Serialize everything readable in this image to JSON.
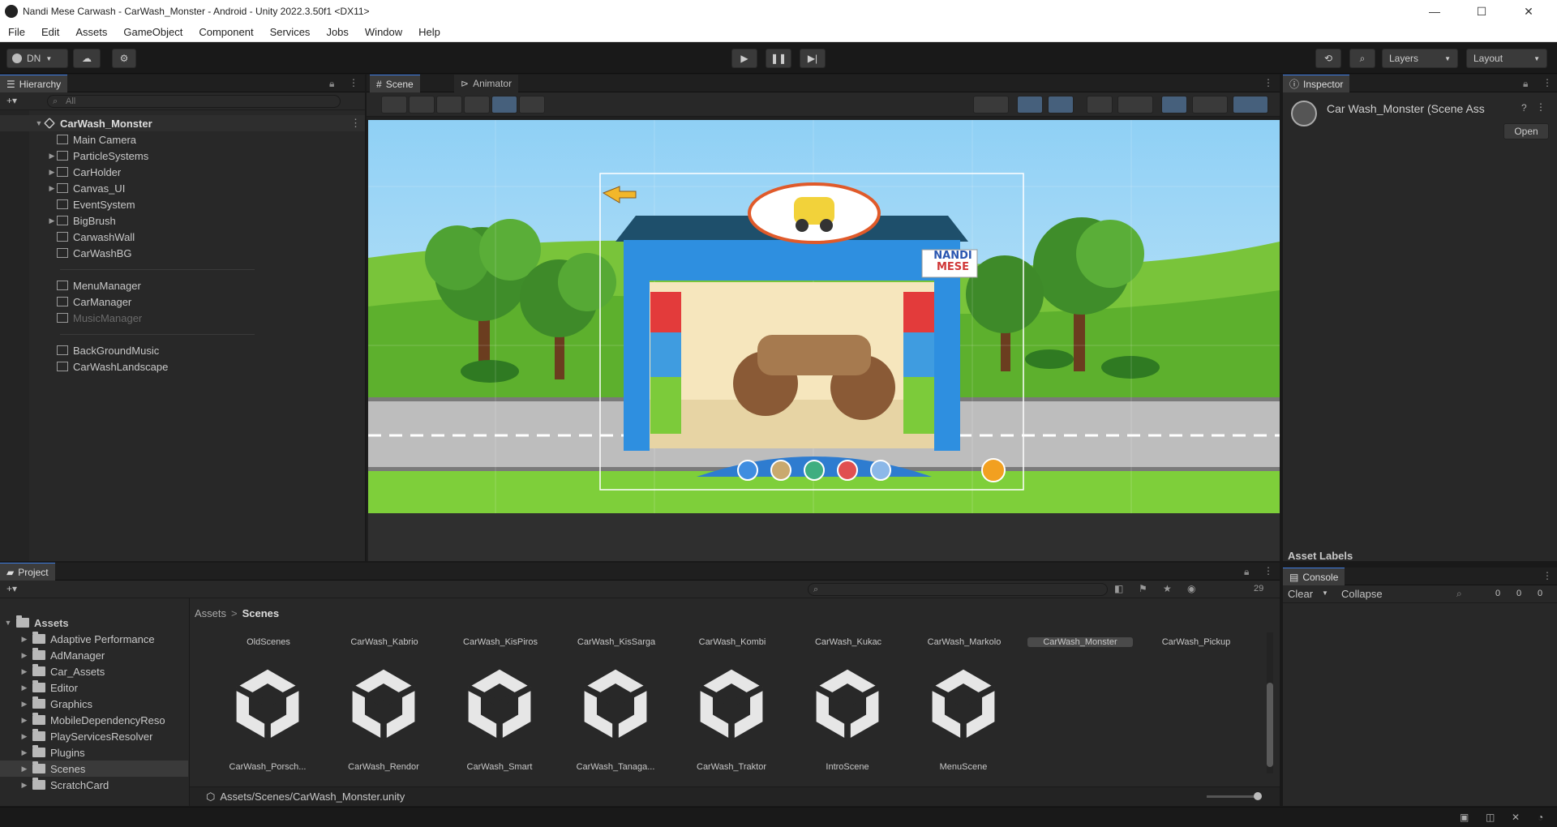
{
  "window": {
    "title": "Nandi Mese Carwash - CarWash_Monster - Android - Unity 2022.3.50f1 <DX11>",
    "minimize": "—",
    "maximize": "☐",
    "close": "✕"
  },
  "menu": [
    "File",
    "Edit",
    "Assets",
    "GameObject",
    "Component",
    "Services",
    "Jobs",
    "Window",
    "Help"
  ],
  "toolbar": {
    "account": "DN",
    "layers": "Layers",
    "layout": "Layout"
  },
  "hierarchy": {
    "tab": "Hierarchy",
    "search_placeholder": "All",
    "scene_name": "CarWash_Monster",
    "items": [
      {
        "label": "Main Camera",
        "expandable": false,
        "dim": false
      },
      {
        "label": "ParticleSystems",
        "expandable": true,
        "dim": false
      },
      {
        "label": "CarHolder",
        "expandable": true,
        "dim": false
      },
      {
        "label": "Canvas_UI",
        "expandable": true,
        "dim": false
      },
      {
        "label": "EventSystem",
        "expandable": false,
        "dim": false
      },
      {
        "label": "BigBrush",
        "expandable": true,
        "dim": false
      },
      {
        "label": "CarwashWall",
        "expandable": false,
        "dim": false
      },
      {
        "label": "CarWashBG",
        "expandable": false,
        "dim": false
      },
      {
        "label": "",
        "expandable": false,
        "dim": true
      },
      {
        "label": "MenuManager",
        "expandable": false,
        "dim": false
      },
      {
        "label": "CarManager",
        "expandable": false,
        "dim": false
      },
      {
        "label": "MusicManager",
        "expandable": false,
        "dim": true
      },
      {
        "label": "",
        "expandable": false,
        "dim": true
      },
      {
        "label": "BackGroundMusic",
        "expandable": false,
        "dim": false
      },
      {
        "label": "CarWashLandscape",
        "expandable": false,
        "dim": false
      }
    ]
  },
  "scene": {
    "tab_scene": "Scene",
    "tab_animator": "Animator",
    "logo_top": "NANDI",
    "logo_bottom": "MESE"
  },
  "inspector": {
    "tab": "Inspector",
    "title": "Car Wash_Monster (Scene Ass",
    "open_button": "Open",
    "asset_labels": "Asset Labels"
  },
  "console": {
    "tab": "Console",
    "clear": "Clear",
    "collapse": "Collapse",
    "counts": [
      "0",
      "0",
      "0"
    ]
  },
  "project": {
    "tab": "Project",
    "breadcrumb": [
      "Assets",
      "Scenes"
    ],
    "root": "Assets",
    "count_badge": "29",
    "folders": [
      "Adaptive Performance",
      "AdManager",
      "Car_Assets",
      "Editor",
      "Graphics",
      "MobileDependencyReso",
      "PlayServicesResolver",
      "Plugins",
      "Scenes",
      "ScratchCard"
    ],
    "top_row": [
      "OldScenes",
      "CarWash_Kabrio",
      "CarWash_KisPiros",
      "CarWash_KisSarga",
      "CarWash_Kombi",
      "CarWash_Kukac",
      "CarWash_Markolo",
      "CarWash_Monster",
      "CarWash_Pickup"
    ],
    "assets": [
      "CarWash_Porsch...",
      "CarWash_Rendor",
      "CarWash_Smart",
      "CarWash_Tanaga...",
      "CarWash_Traktor",
      "IntroScene",
      "MenuScene"
    ],
    "path": "Assets/Scenes/CarWash_Monster.unity"
  }
}
